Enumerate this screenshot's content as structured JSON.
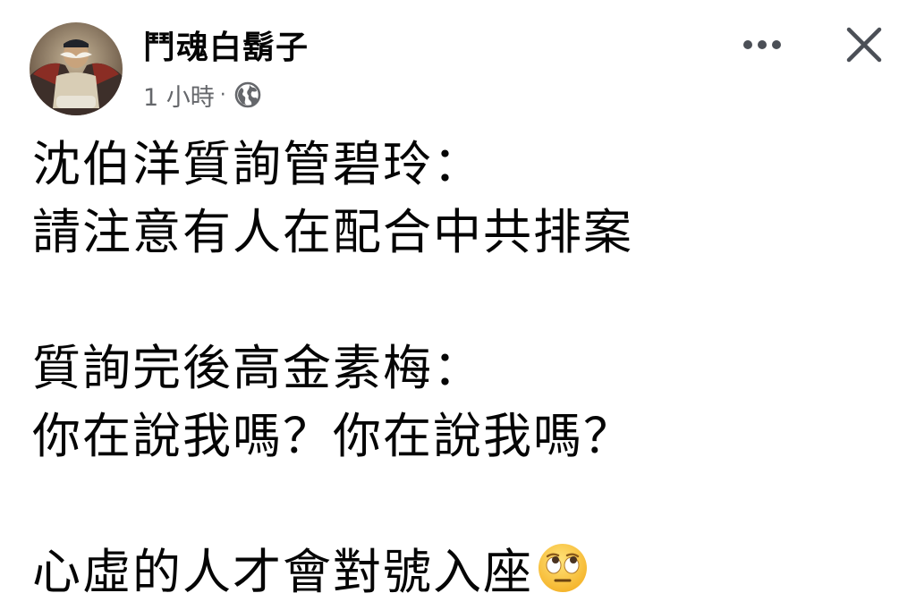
{
  "post": {
    "author": "鬥魂白鬍子",
    "time": "1 小時",
    "separator": "·",
    "privacy_icon": "globe-icon",
    "more_icon": "more-horizontal-icon",
    "close_icon": "close-icon",
    "lines": [
      "沈伯洋質詢管碧玲：",
      "請注意有人在配合中共排案",
      "質詢完後高金素梅：",
      "你在說我嗎？你在說我嗎？",
      "心虛的人才會對號入座"
    ],
    "trailing_emoji": "face-with-rolling-eyes-emoji"
  },
  "colors": {
    "text": "#050505",
    "secondary": "#65676b",
    "icon": "#4b4f56"
  }
}
